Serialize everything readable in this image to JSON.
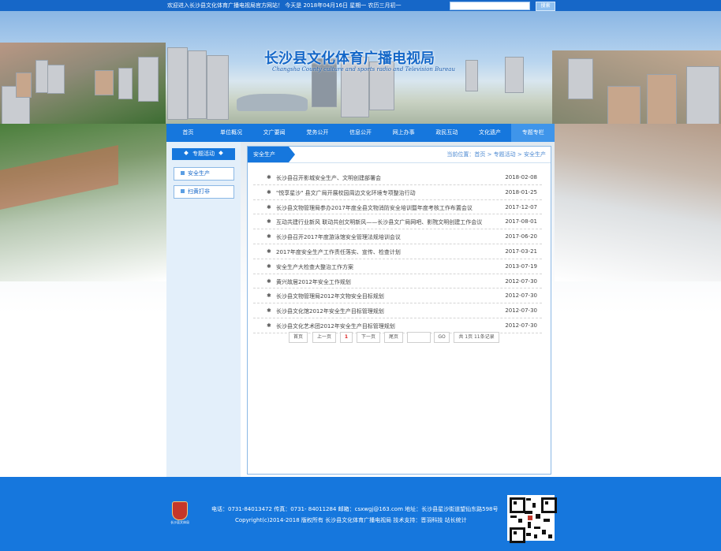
{
  "topbar": {
    "welcome": "欢迎进入长沙县文化体育广播电视局官方网站！  今天是 2018年04月16日 星期一  农历三月初一",
    "search_placeholder": "",
    "search_button": "搜索"
  },
  "header": {
    "title": "长沙县文化体育广播电视局",
    "subtitle": "Changsha County culture and sports radio and Television Bureau"
  },
  "nav": [
    {
      "label": "首页"
    },
    {
      "label": "单位概况"
    },
    {
      "label": "文广要闻"
    },
    {
      "label": "党务公开"
    },
    {
      "label": "信息公开"
    },
    {
      "label": "网上办事"
    },
    {
      "label": "政民互动"
    },
    {
      "label": "文化遗产"
    },
    {
      "label": "专题专栏"
    }
  ],
  "sidebar": {
    "title": "专题活动",
    "items": [
      {
        "label": "安全生产"
      },
      {
        "label": "扫黄打非"
      }
    ]
  },
  "panel": {
    "tab": "安全生产",
    "breadcrumb": "当前位置：首页 > 专题活动 > 安全生产"
  },
  "articles": [
    {
      "title": "长沙县召开影城安全生产、文明创建部署会",
      "date": "2018-02-08"
    },
    {
      "title": "\"悦享星沙\" 县文广局开展校园周边文化环境专项整治行动",
      "date": "2018-01-25"
    },
    {
      "title": "长沙县文物管理局参办2017年度全县文物消防安全培训暨年度考核工作布置会议",
      "date": "2017-12-07"
    },
    {
      "title": "互动共建行业新风 联动共创文明新风——长沙县文广局网吧、影院文明创建工作会议",
      "date": "2017-08-01"
    },
    {
      "title": "长沙县召开2017年度游泳馆安全管理法规培训会议",
      "date": "2017-06-20"
    },
    {
      "title": "2017年度安全生产工作责任落实、宣传、检查计划",
      "date": "2017-03-21"
    },
    {
      "title": "安全生产大检查大整治工作方案",
      "date": "2013-07-19"
    },
    {
      "title": "黄兴故居2012年安全工作规划",
      "date": "2012-07-30"
    },
    {
      "title": "长沙县文物管理局2012年文物安全目标规划",
      "date": "2012-07-30"
    },
    {
      "title": "长沙县文化馆2012年安全生产目标管理规划",
      "date": "2012-07-30"
    },
    {
      "title": "长沙县文化艺术团2012年安全生产目标管理规划",
      "date": "2012-07-30"
    }
  ],
  "pagination": {
    "first": "首页",
    "prev": "上一页",
    "current": "1",
    "next": "下一页",
    "last": "尾页",
    "go": "GO",
    "summary": "共 1页 11条记录"
  },
  "footer": {
    "logo_text": "长沙县文体局",
    "contact": "电话：0731-84013472 传真：0731- 84011284 邮箱：csxwgj@163.com 地址：长沙县星沙街道望仙东路598号",
    "copyright": "Copyright(c)2014-2018 版权所有 长沙县文化体育广播电视局   技术支持：晋羽科技   站长统计"
  },
  "colors": {
    "primary": "#1677dd",
    "topbar": "#1667c8",
    "sidebar_bg": "#e3effa",
    "current_page": "#dd2222"
  }
}
